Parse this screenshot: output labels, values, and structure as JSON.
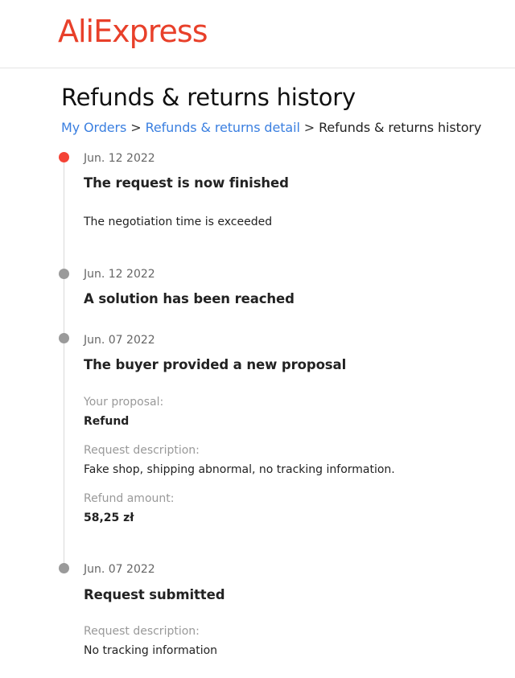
{
  "header": {
    "logo_text": "AliExpress"
  },
  "page": {
    "title": "Refunds & returns history"
  },
  "breadcrumb": {
    "items": [
      {
        "label": "My Orders"
      },
      {
        "label": "Refunds & returns detail"
      },
      {
        "label": "Refunds & returns history"
      }
    ],
    "separator": ">"
  },
  "timeline": [
    {
      "date": "Jun. 12 2022",
      "title": "The request is now finished",
      "details": "The negotiation time is exceeded"
    },
    {
      "date": "Jun. 12 2022",
      "title": "A solution has been reached"
    },
    {
      "date": "Jun. 07 2022",
      "title": "The buyer provided a new proposal",
      "fields": [
        {
          "label": "Your proposal:",
          "value": "Refund"
        },
        {
          "label": "Request description:",
          "value": "Fake shop, shipping abnormal, no tracking information."
        },
        {
          "label": "Refund amount:",
          "value": "58,25 zł"
        }
      ]
    },
    {
      "date": "Jun. 07 2022",
      "title": "Request submitted",
      "fields": [
        {
          "label": "Request description:",
          "value": "No tracking information"
        }
      ]
    }
  ],
  "colors": {
    "brand": "#e8402a",
    "link": "#3a7fe0",
    "active_dot": "#f44336",
    "inactive_dot": "#9a9a9a"
  }
}
